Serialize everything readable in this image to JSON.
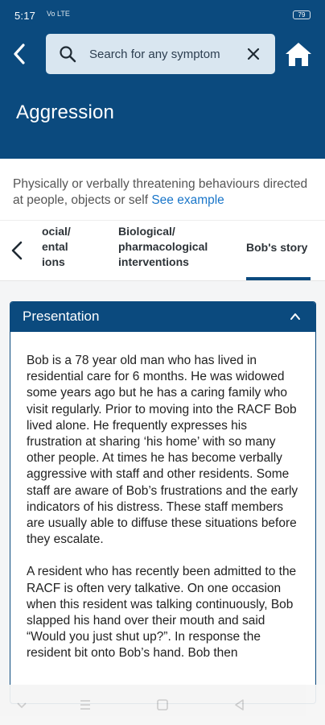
{
  "status_bar": {
    "time": "5:17",
    "signal": "Vo LTE",
    "battery": "79"
  },
  "header": {
    "back_icon": "chevron-left-icon",
    "search": {
      "placeholder": "Search for any symptom",
      "search_icon": "search-icon",
      "clear_icon": "close-icon"
    },
    "home_icon": "home-icon",
    "title": "Aggression"
  },
  "description": {
    "text": "Physically or verbally threatening behaviours directed at people, objects or self ",
    "link": "See example"
  },
  "tabs": {
    "back_icon": "chevron-left-icon",
    "items": [
      {
        "label": "ocial/ ental ions"
      },
      {
        "label": "Biological/ pharmacological interventions"
      },
      {
        "label": "Bob's story",
        "active": true
      }
    ]
  },
  "section": {
    "title": "Presentation",
    "chevron_icon": "chevron-up-icon",
    "paragraphs": [
      "Bob is a 78 year old man who has lived in residential care for 6 months. He was widowed some years ago but he has a caring family who visit regularly. Prior to moving into the RACF Bob lived alone. He frequently expresses his frustration at sharing ‘his home’ with so many other people. At times he has become verbally aggressive with staff and other residents. Some staff are aware of Bob’s frustrations and the early indicators of his distress. These staff members are usually able to diffuse these situations before they escalate.",
      "A resident who has recently been admitted to the RACF is often very talkative. On one occasion when this resident was talking continuously, Bob slapped his hand over their mouth and said “Would you just shut up?”. In response the resident bit onto Bob’s hand. Bob then"
    ]
  },
  "nav_bar": {
    "icons": [
      "chevron-down-icon",
      "menu-icon",
      "square-icon",
      "back-triangle-icon"
    ]
  },
  "colors": {
    "primary": "#0b4a7e",
    "link": "#1a76c9",
    "search_bg": "#d9e6f0",
    "content_bg": "#f4f5f6"
  }
}
